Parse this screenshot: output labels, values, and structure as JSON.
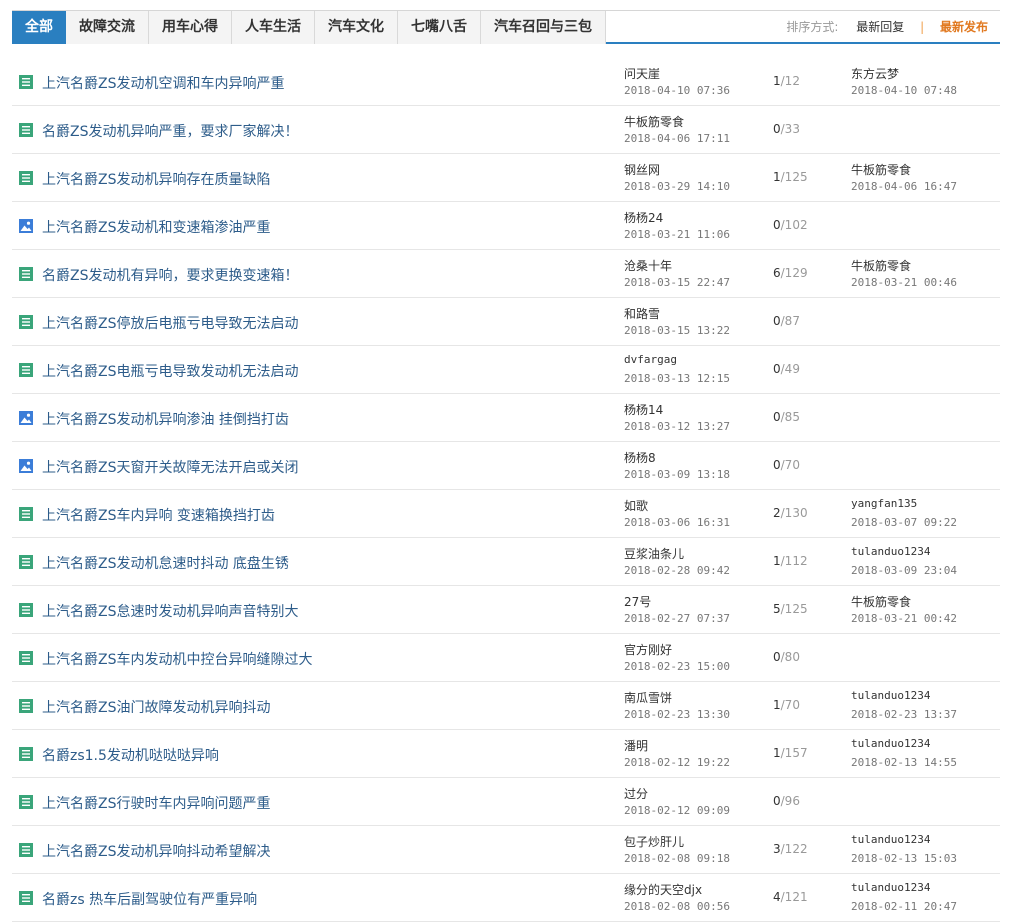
{
  "tabs": [
    {
      "label": "全部",
      "active": true
    },
    {
      "label": "故障交流",
      "active": false
    },
    {
      "label": "用车心得",
      "active": false
    },
    {
      "label": "人车生活",
      "active": false
    },
    {
      "label": "汽车文化",
      "active": false
    },
    {
      "label": "七嘴八舌",
      "active": false
    },
    {
      "label": "汽车召回与三包",
      "active": false
    }
  ],
  "sort": {
    "label": "排序方式:",
    "options": [
      {
        "label": "最新回复",
        "active": false
      },
      {
        "label": "最新发布",
        "active": true
      }
    ]
  },
  "colors": {
    "accent": "#2a7fc0",
    "title_link": "#2d5c8a",
    "sort_active": "#e17920",
    "text_icon": "#3aa57a",
    "image_icon": "#3b7dd8"
  },
  "topics": [
    {
      "icon": "text-doc-icon",
      "title": "上汽名爵ZS发动机空调和车内异响严重",
      "author": "问天崖",
      "date": "2018-04-10 07:36",
      "replies": "1",
      "views": "/12",
      "last_user": "东方云梦",
      "last_date": "2018-04-10 07:48"
    },
    {
      "icon": "text-doc-icon",
      "title": "名爵ZS发动机异响严重，要求厂家解决！",
      "author": "牛板筋零食",
      "date": "2018-04-06 17:11",
      "replies": "0",
      "views": "/33",
      "last_user": "",
      "last_date": ""
    },
    {
      "icon": "text-doc-icon",
      "title": "上汽名爵ZS发动机异响存在质量缺陷",
      "author": "钢丝网",
      "date": "2018-03-29 14:10",
      "replies": "1",
      "views": "/125",
      "last_user": "牛板筋零食",
      "last_date": "2018-04-06 16:47"
    },
    {
      "icon": "image-icon",
      "title": "上汽名爵ZS发动机和变速箱渗油严重",
      "author": "杨杨24",
      "date": "2018-03-21 11:06",
      "replies": "0",
      "views": "/102",
      "last_user": "",
      "last_date": ""
    },
    {
      "icon": "text-doc-icon",
      "title": "名爵ZS发动机有异响，要求更换变速箱！",
      "author": "沧桑十年",
      "date": "2018-03-15 22:47",
      "replies": "6",
      "views": "/129",
      "last_user": "牛板筋零食",
      "last_date": "2018-03-21 00:46"
    },
    {
      "icon": "text-doc-icon",
      "title": "上汽名爵ZS停放后电瓶亏电导致无法启动",
      "author": "和路雪",
      "date": "2018-03-15 13:22",
      "replies": "0",
      "views": "/87",
      "last_user": "",
      "last_date": ""
    },
    {
      "icon": "text-doc-icon",
      "title": "上汽名爵ZS电瓶亏电导致发动机无法启动",
      "author": "dvfargag",
      "date": "2018-03-13 12:15",
      "replies": "0",
      "views": "/49",
      "last_user": "",
      "last_date": ""
    },
    {
      "icon": "image-icon",
      "title": "上汽名爵ZS发动机异响渗油 挂倒挡打齿",
      "author": "杨杨14",
      "date": "2018-03-12 13:27",
      "replies": "0",
      "views": "/85",
      "last_user": "",
      "last_date": ""
    },
    {
      "icon": "image-icon",
      "title": "上汽名爵ZS天窗开关故障无法开启或关闭",
      "author": "杨杨8",
      "date": "2018-03-09 13:18",
      "replies": "0",
      "views": "/70",
      "last_user": "",
      "last_date": ""
    },
    {
      "icon": "text-doc-icon",
      "title": "上汽名爵ZS车内异响 变速箱换挡打齿",
      "author": "如歌",
      "date": "2018-03-06 16:31",
      "replies": "2",
      "views": "/130",
      "last_user": "yangfan135",
      "last_date": "2018-03-07 09:22"
    },
    {
      "icon": "text-doc-icon",
      "title": "上汽名爵ZS发动机怠速时抖动 底盘生锈",
      "author": "豆浆油条儿",
      "date": "2018-02-28 09:42",
      "replies": "1",
      "views": "/112",
      "last_user": "tulanduo1234",
      "last_date": "2018-03-09 23:04"
    },
    {
      "icon": "text-doc-icon",
      "title": "上汽名爵ZS怠速时发动机异响声音特别大",
      "author": "27号",
      "date": "2018-02-27 07:37",
      "replies": "5",
      "views": "/125",
      "last_user": "牛板筋零食",
      "last_date": "2018-03-21 00:42"
    },
    {
      "icon": "text-doc-icon",
      "title": "上汽名爵ZS车内发动机中控台异响缝隙过大",
      "author": "官方刚好",
      "date": "2018-02-23 15:00",
      "replies": "0",
      "views": "/80",
      "last_user": "",
      "last_date": ""
    },
    {
      "icon": "text-doc-icon",
      "title": "上汽名爵ZS油门故障发动机异响抖动",
      "author": "南瓜雪饼",
      "date": "2018-02-23 13:30",
      "replies": "1",
      "views": "/70",
      "last_user": "tulanduo1234",
      "last_date": "2018-02-23 13:37"
    },
    {
      "icon": "text-doc-icon",
      "title": "名爵zs1.5发动机哒哒哒异响",
      "author": "潘明",
      "date": "2018-02-12 19:22",
      "replies": "1",
      "views": "/157",
      "last_user": "tulanduo1234",
      "last_date": "2018-02-13 14:55"
    },
    {
      "icon": "text-doc-icon",
      "title": "上汽名爵ZS行驶时车内异响问题严重",
      "author": "过分",
      "date": "2018-02-12 09:09",
      "replies": "0",
      "views": "/96",
      "last_user": "",
      "last_date": ""
    },
    {
      "icon": "text-doc-icon",
      "title": "上汽名爵ZS发动机异响抖动希望解决",
      "author": "包子炒肝儿",
      "date": "2018-02-08 09:18",
      "replies": "3",
      "views": "/122",
      "last_user": "tulanduo1234",
      "last_date": "2018-02-13 15:03"
    },
    {
      "icon": "text-doc-icon",
      "title": "名爵zs 热车后副驾驶位有严重异响",
      "author": "缘分的天空djx",
      "date": "2018-02-08 00:56",
      "replies": "4",
      "views": "/121",
      "last_user": "tulanduo1234",
      "last_date": "2018-02-11 20:47"
    }
  ]
}
